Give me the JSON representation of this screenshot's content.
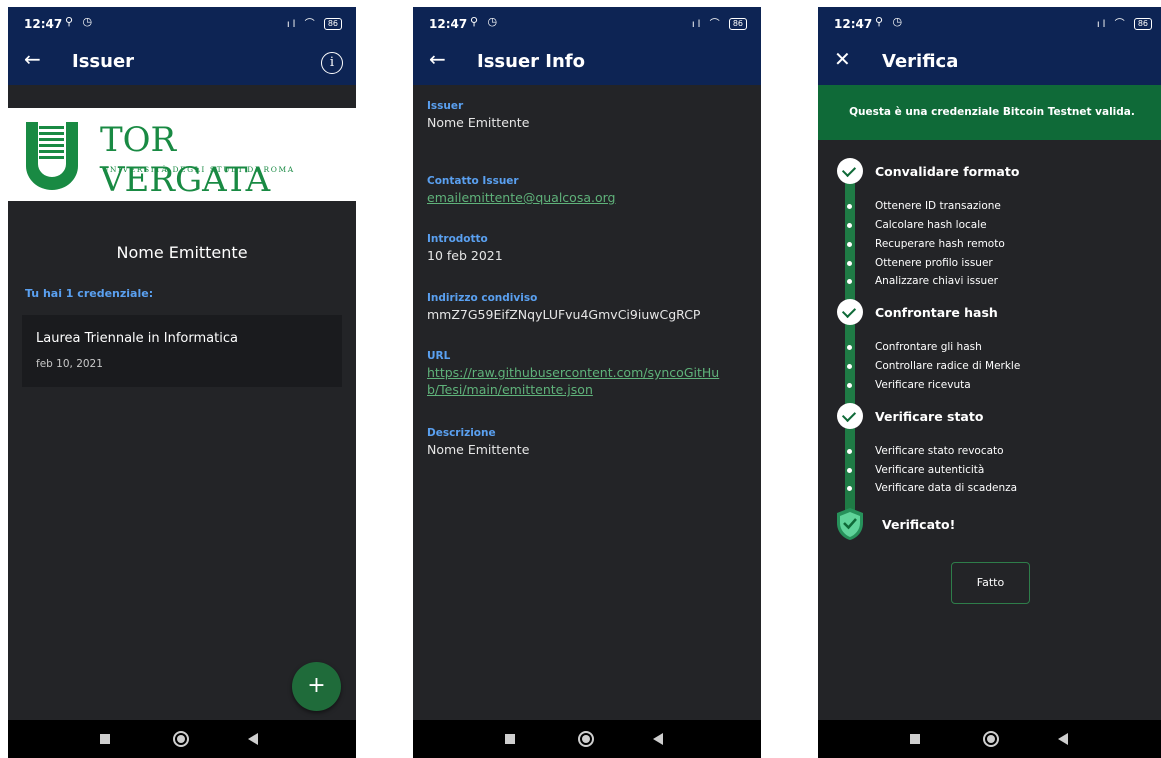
{
  "status_bar": {
    "time": "12:47",
    "left_icons": "⚲ ◷",
    "right_icons": "ıl ⌒",
    "battery": "86"
  },
  "colors": {
    "app_bar": "#0d2454",
    "accent_blue": "#5aa0f0",
    "accent_green": "#0f6a38",
    "link_green": "#5fb27a",
    "background": "#232427"
  },
  "screen_issuer": {
    "title": "Issuer",
    "back_icon": "arrow-left-icon",
    "info_icon": "info-icon",
    "info_glyph": "i",
    "logo": {
      "title": "TOR VERGATA",
      "subtitle": "UNIVERSITÀ DEGLI STUDI DI ROMA"
    },
    "issuer_name": "Nome Emittente",
    "credentials_count_label": "Tu hai 1 credenziale:",
    "credentials": [
      {
        "title": "Laurea Triennale in Informatica",
        "date": "feb 10, 2021"
      }
    ],
    "fab_label": "+"
  },
  "screen_issuer_info": {
    "title": "Issuer Info",
    "back_icon": "arrow-left-icon",
    "fields": [
      {
        "label": "Issuer",
        "value": "Nome Emittente"
      },
      {
        "label": "Contatto Issuer",
        "value": "emailemittente@qualcosa.org"
      },
      {
        "label": "Introdotto",
        "value": "10 feb 2021"
      },
      {
        "label": "Indirizzo condiviso",
        "value": "mmZ7G59EifZNqyLUFvu4GmvCi9iuwCgRCP"
      },
      {
        "label": "URL",
        "value": "https://raw.githubusercontent.com/syncoGitHub/Tesi/main/emittente.json"
      },
      {
        "label": "Descrizione",
        "value": "Nome Emittente"
      }
    ]
  },
  "screen_verify": {
    "title": "Verifica",
    "close_icon": "close-icon",
    "banner": "Questa è una credenziale Bitcoin Testnet valida.",
    "steps": [
      {
        "title": "Convalidare formato",
        "substeps": [
          "Ottenere ID transazione",
          "Calcolare hash locale",
          "Recuperare hash remoto",
          "Ottenere profilo issuer",
          "Analizzare chiavi issuer"
        ]
      },
      {
        "title": "Confrontare hash",
        "substeps": [
          "Confrontare gli hash",
          "Controllare radice di Merkle",
          "Verificare ricevuta"
        ]
      },
      {
        "title": "Verificare stato",
        "substeps": [
          "Verificare stato revocato",
          "Verificare autenticità",
          "Verificare data di scadenza"
        ]
      }
    ],
    "final": "Verificato!",
    "done_button": "Fatto"
  },
  "nav_icons": [
    "recents-icon",
    "home-icon",
    "back-icon"
  ]
}
